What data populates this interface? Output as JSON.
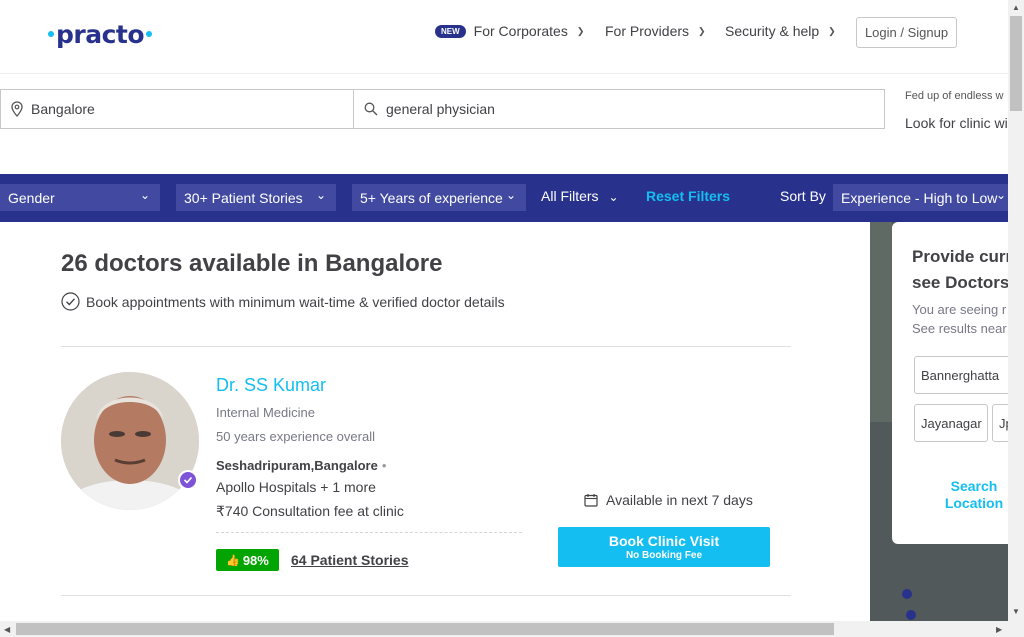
{
  "header": {
    "logo": "practo",
    "nav": {
      "new_badge": "NEW",
      "corporates": "For Corporates",
      "providers": "For Providers",
      "security": "Security & help"
    },
    "login": "Login / Signup"
  },
  "search": {
    "location_value": "Bangalore",
    "query_value": "general physician",
    "promo_line1": "Fed up of endless w",
    "promo_line2": "Look for clinic wi"
  },
  "filters": {
    "gender": "Gender",
    "patient_stories": "30+ Patient Stories",
    "experience": "5+ Years of experience",
    "all_filters": "All Filters",
    "reset": "Reset Filters",
    "sort_by_label": "Sort By",
    "sort_value": "Experience - High to Low"
  },
  "results": {
    "title": "26 doctors available in Bangalore",
    "subtitle": "Book appointments with minimum wait-time & verified doctor details"
  },
  "doctor": {
    "name": "Dr. SS Kumar",
    "specialty": "Internal Medicine",
    "experience": "50 years experience overall",
    "locality": "Seshadripuram,Bangalore",
    "clinic": "Apollo Hospitals + 1 more",
    "fee": "₹740 Consultation fee at clinic",
    "rating": "98%",
    "stories": "64 Patient Stories",
    "availability": "Available in next 7 days",
    "book_label": "Book Clinic Visit",
    "book_sub": "No Booking Fee"
  },
  "location_panel": {
    "title_line1": "Provide curr",
    "title_line2": "see Doctors",
    "sub_line1": "You are seeing r",
    "sub_line2": "See results near",
    "chip1": "Bannerghatta",
    "chip2": "Jayanagar",
    "chip3": "Jp",
    "search_line1": "Search",
    "search_line2": "Location"
  },
  "colors": {
    "brand_navy": "#28328c",
    "accent_blue": "#14bef0",
    "rating_green": "#01a400",
    "verified_purple": "#7d54d6"
  }
}
